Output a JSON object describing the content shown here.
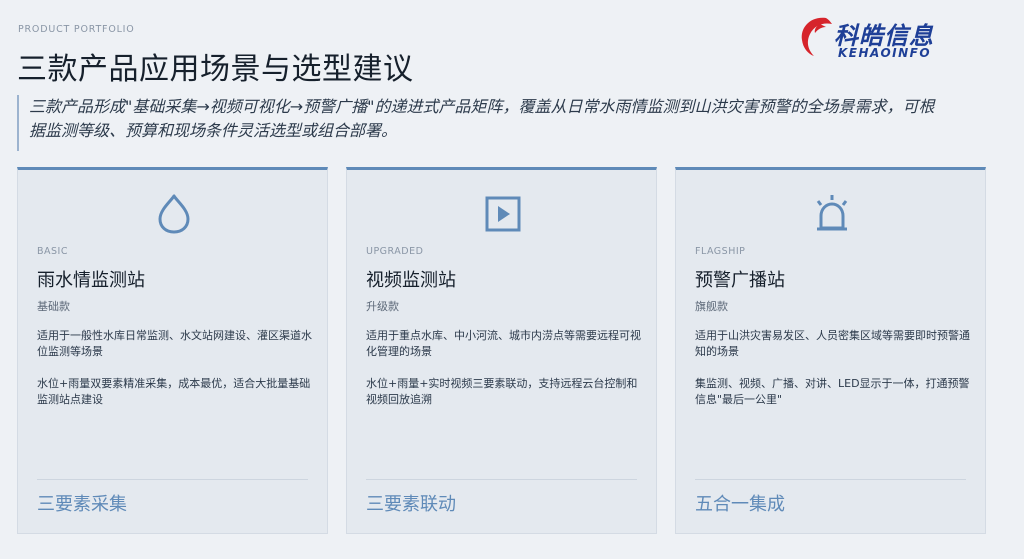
{
  "header": {
    "eyebrow": "PRODUCT PORTFOLIO",
    "title": "三款产品应用场景与选型建议"
  },
  "logo": {
    "name_cn": "科皓信息",
    "name_en": "KEHAOINFO"
  },
  "lead": "三款产品形成\"基础采集→视频可视化→预警广播\"的递进式产品矩阵，覆盖从日常水雨情监测到山洪灾害预警的全场景需求，可根据监测等级、预算和现场条件灵活选型或组合部署。",
  "cards": [
    {
      "icon": "water-drop-icon",
      "tier": "BASIC",
      "name": "雨水情监测站",
      "sub": "基础款",
      "desc": "适用于一般性水库日常监测、水文站网建设、灌区渠道水位监测等场景",
      "feature": "水位+雨量双要素精准采集，成本最优，适合大批量基础监测站点建设",
      "tag": "三要素采集"
    },
    {
      "icon": "video-play-icon",
      "tier": "UPGRADED",
      "name": "视频监测站",
      "sub": "升级款",
      "desc": "适用于重点水库、中小河流、城市内涝点等需要远程可视化管理的场景",
      "feature": "水位+雨量+实时视频三要素联动，支持远程云台控制和视频回放追溯",
      "tag": "三要素联动"
    },
    {
      "icon": "alarm-siren-icon",
      "tier": "FLAGSHIP",
      "name": "预警广播站",
      "sub": "旗舰款",
      "desc": "适用于山洪灾害易发区、人员密集区域等需要即时预警通知的场景",
      "feature": "集监测、视频、广播、对讲、LED显示于一体，打通预警信息\"最后一公里\"",
      "tag": "五合一集成"
    }
  ],
  "colors": {
    "accent": "#5f8ab8",
    "logo_blue": "#1e3f97",
    "logo_red": "#d6242b",
    "background": "#eef1f5",
    "card": "#e4e9ef"
  }
}
